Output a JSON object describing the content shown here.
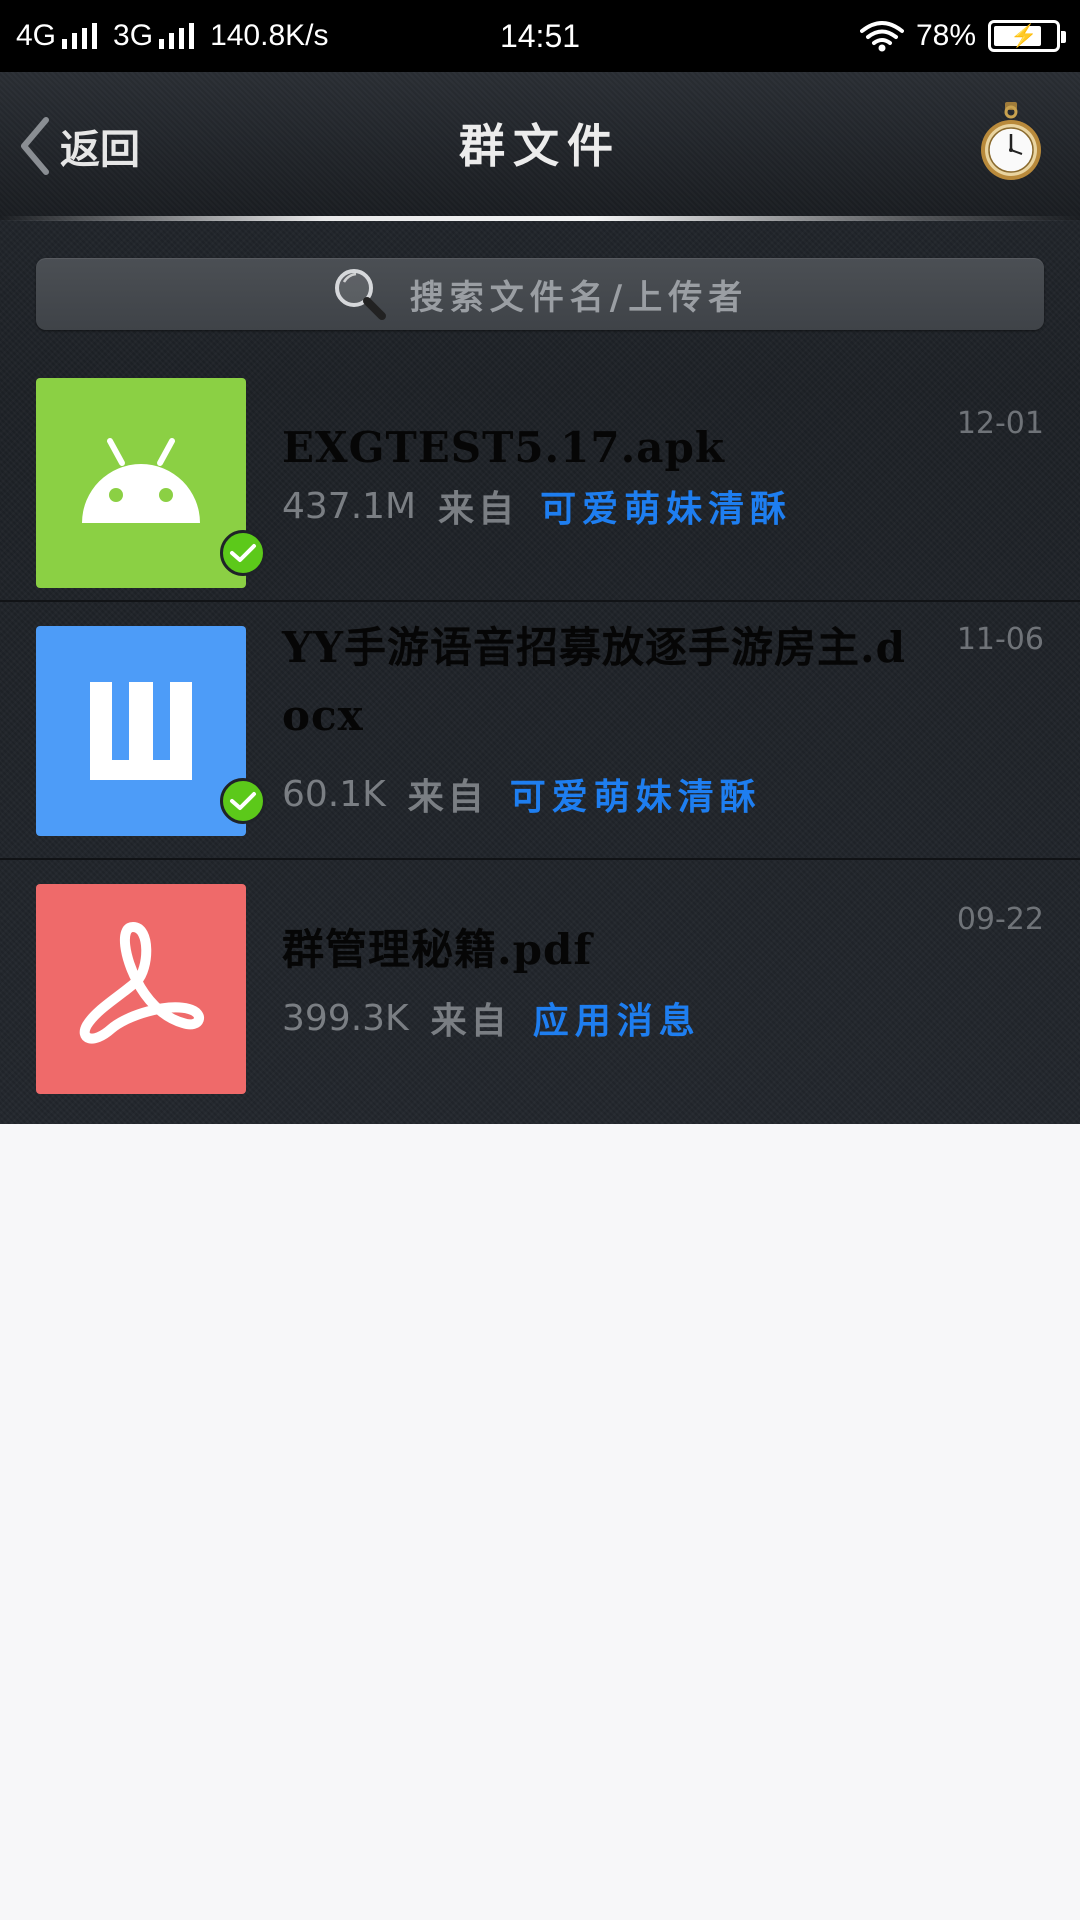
{
  "status_bar": {
    "net1": "4G",
    "net2": "3G",
    "speed": "140.8K/s",
    "time": "14:51",
    "battery_percent": "78%",
    "battery_level": 0.78
  },
  "header": {
    "back_label": "返回",
    "title": "群文件"
  },
  "search": {
    "placeholder": "搜索文件名/上传者"
  },
  "files": [
    {
      "name": "EXGTEST5.17.apk",
      "size": "437.1M",
      "from_label": "来自",
      "uploader": "可爱萌妹清酥",
      "date": "12-01",
      "icon": "android-icon",
      "color": "#8bd044",
      "downloaded": true
    },
    {
      "name": "YY手游语音招募放逐手游房主.docx",
      "size": "60.1K",
      "from_label": "来自",
      "uploader": "可爱萌妹清酥",
      "date": "11-06",
      "icon": "word-document-icon",
      "color": "#4d9cf8",
      "downloaded": true
    },
    {
      "name": "群管理秘籍.pdf",
      "size": "399.3K",
      "from_label": "来自",
      "uploader": "应用消息",
      "date": "09-22",
      "icon": "pdf-acrobat-icon",
      "color": "#ef6a6a",
      "downloaded": false
    }
  ]
}
